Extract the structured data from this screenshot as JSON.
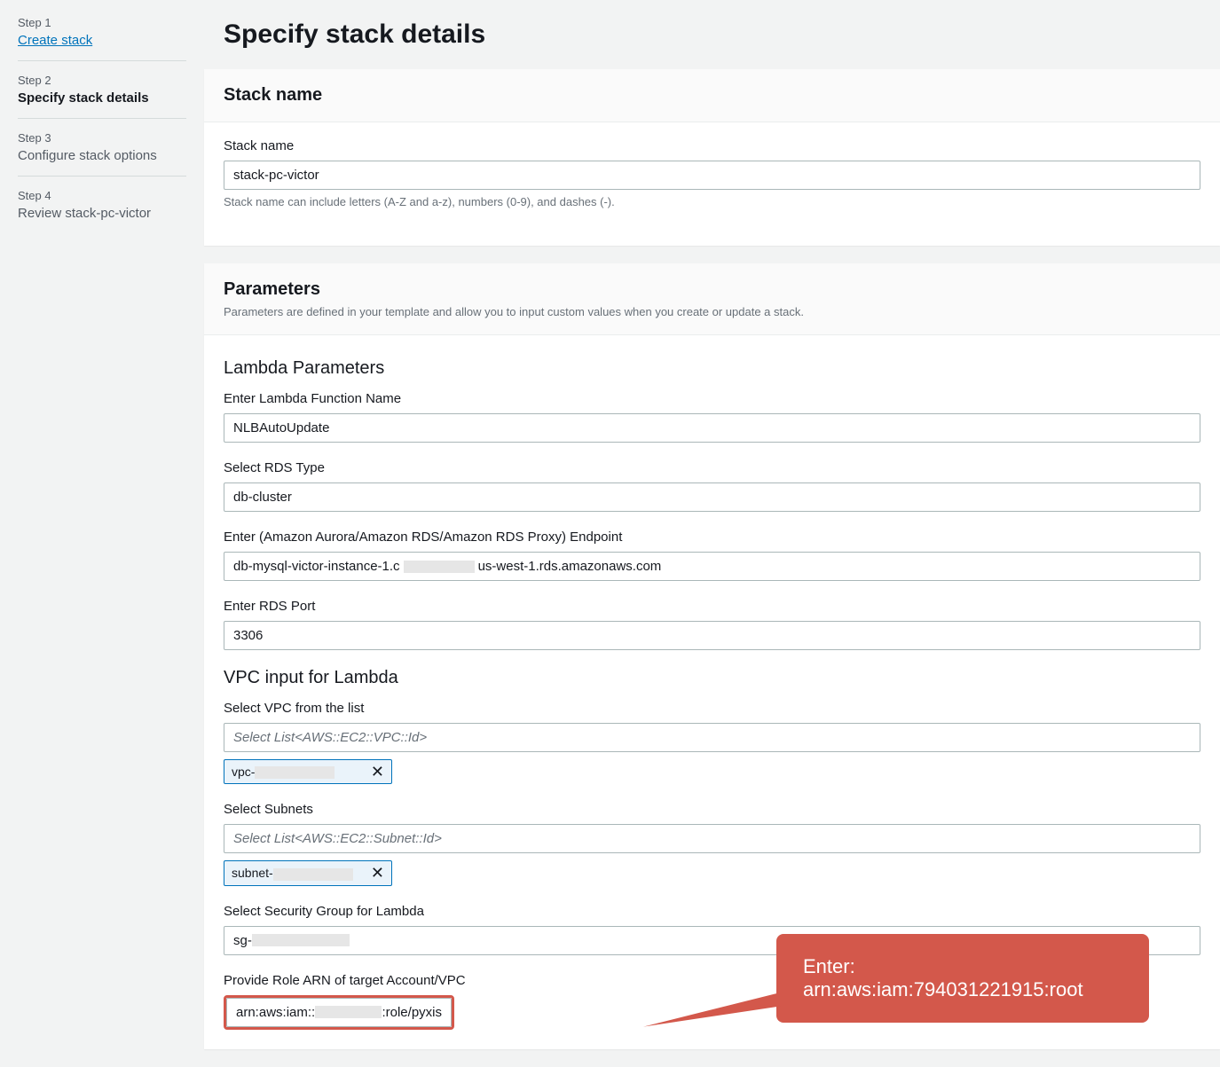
{
  "sidebar": {
    "steps": [
      {
        "label": "Step 1",
        "title": "Create stack",
        "style": "link"
      },
      {
        "label": "Step 2",
        "title": "Specify stack details",
        "style": "active"
      },
      {
        "label": "Step 3",
        "title": "Configure stack options",
        "style": "normal"
      },
      {
        "label": "Step 4",
        "title": "Review stack-pc-victor",
        "style": "normal"
      }
    ]
  },
  "page_title": "Specify stack details",
  "stack_name_panel": {
    "header": "Stack name",
    "label": "Stack name",
    "value": "stack-pc-victor",
    "hint": "Stack name can include letters (A-Z and a-z), numbers (0-9), and dashes (-)."
  },
  "parameters_panel": {
    "header": "Parameters",
    "subdesc": "Parameters are defined in your template and allow you to input custom values when you create or update a stack.",
    "lambda_section_title": "Lambda Parameters",
    "lambda_name": {
      "label": "Enter Lambda Function Name",
      "value": "NLBAutoUpdate"
    },
    "rds_type": {
      "label": "Select RDS Type",
      "value": "db-cluster"
    },
    "endpoint": {
      "label": "Enter (Amazon Aurora/Amazon RDS/Amazon RDS Proxy) Endpoint",
      "prefix": "db-mysql-victor-instance-1.c",
      "suffix": "us-west-1.rds.amazonaws.com"
    },
    "rds_port": {
      "label": "Enter RDS Port",
      "value": "3306"
    },
    "vpc_section_title": "VPC input for Lambda",
    "vpc": {
      "label": "Select VPC from the list",
      "placeholder": "Select List<AWS::EC2::VPC::Id>",
      "tag_prefix": "vpc-"
    },
    "subnets": {
      "label": "Select Subnets",
      "placeholder": "Select List<AWS::EC2::Subnet::Id>",
      "tag_prefix": "subnet-"
    },
    "sg": {
      "label": "Select Security Group for Lambda",
      "prefix": "sg-"
    },
    "role_arn": {
      "label": "Provide Role ARN of target Account/VPC",
      "prefix": "arn:aws:iam::",
      "suffix": ":role/pyxis"
    }
  },
  "callout": {
    "line1": "Enter:",
    "line2": "arn:aws:iam:794031221915:root"
  }
}
